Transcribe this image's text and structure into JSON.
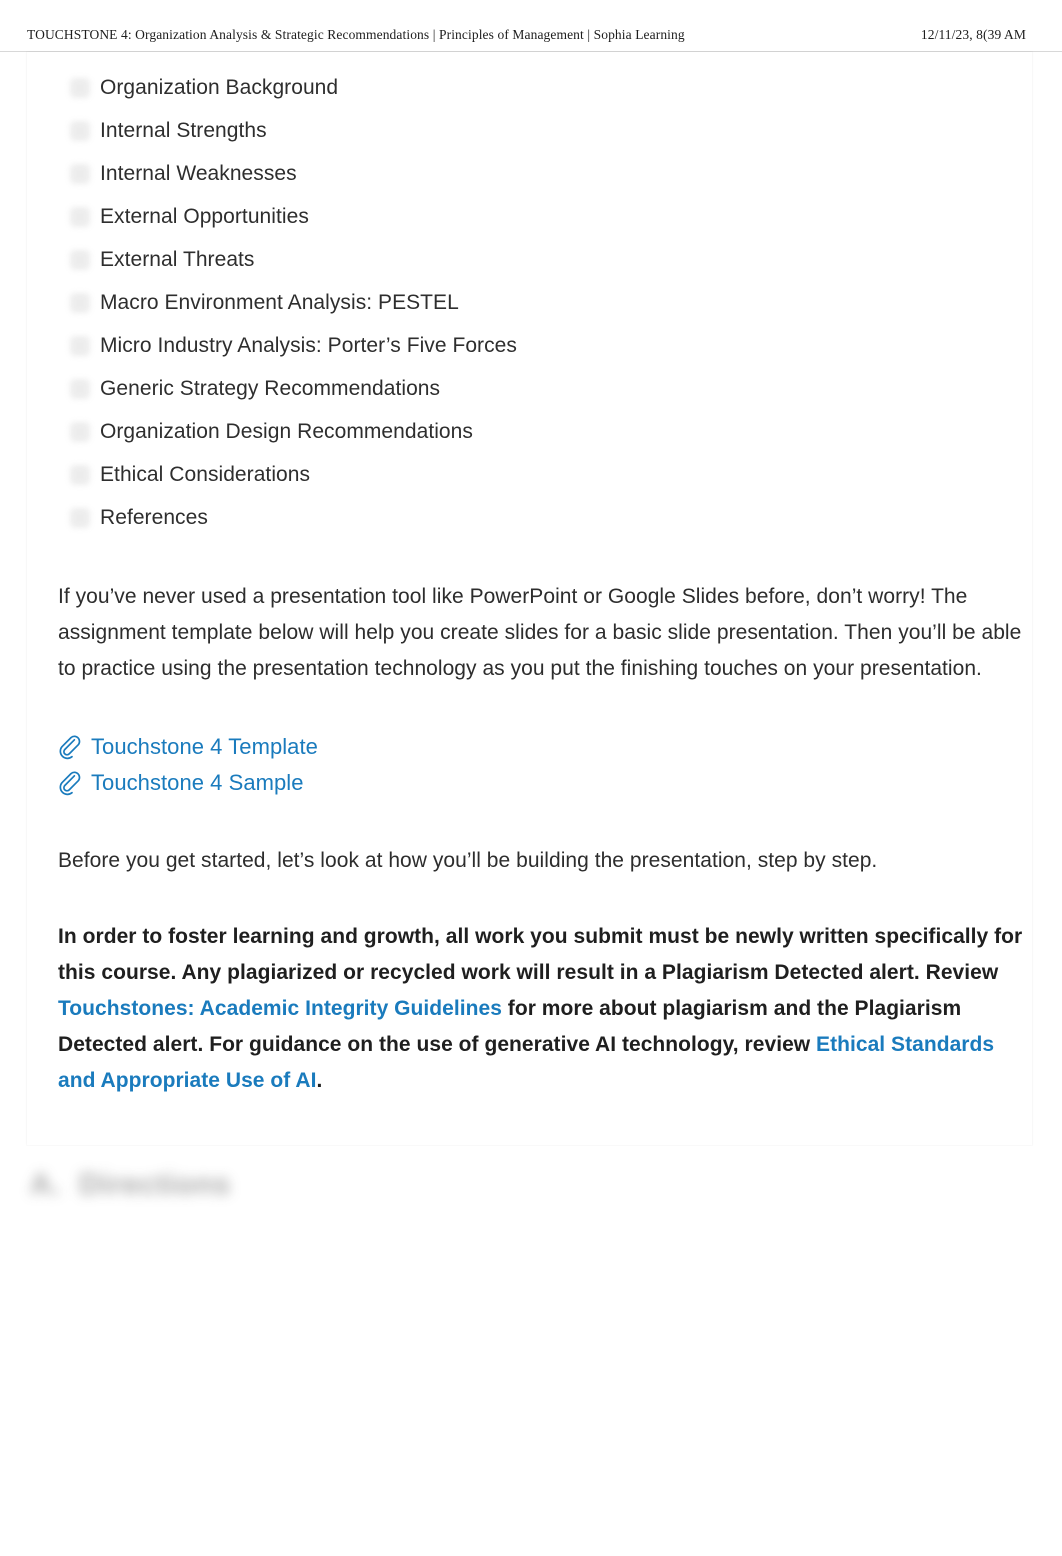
{
  "print_header": {
    "title": "TOUCHSTONE 4: Organization Analysis & Strategic Recommendations | Principles of Management | Sophia Learning",
    "date": "12/11/23, 8(39 AM"
  },
  "outline_list": {
    "bullet_icon": "square-placeholder-icon",
    "items": [
      "Organization Background",
      "Internal Strengths",
      "Internal Weaknesses",
      "External Opportunities",
      "External Threats",
      "Macro Environment Analysis: PESTEL",
      "Micro Industry Analysis: Porter’s Five Forces",
      "Generic Strategy Recommendations",
      "Organization Design Recommendations",
      "Ethical Considerations",
      "References"
    ]
  },
  "intro_paragraph": "If you’ve never used a presentation tool like PowerPoint or Google Slides before, don’t worry! The assignment template below will help you create slides for a basic slide presentation. Then you’ll be able to practice using the presentation technology as you put the finishing touches on your presentation.",
  "attachments": {
    "icon": "paperclip-icon",
    "items": [
      {
        "label": "Touchstone 4 Template"
      },
      {
        "label": "Touchstone 4 Sample"
      }
    ]
  },
  "before_paragraph": "Before you get started, let’s look at how you’ll be building the presentation, step by step.",
  "notice_paragraph": {
    "part1": "In order to foster learning and growth, all work you submit must be newly written specifically for this course. Any plagiarized or recycled work will result in a Plagiarism Detected alert. Review ",
    "link1": "Touchstones: Academic Integrity Guidelines",
    "part2": " for more about plagiarism and the Plagiarism Detected alert. For guidance on the use of generative AI technology, review ",
    "link2": "Ethical Standards and Appropriate Use of AI",
    "part3": "."
  },
  "blurred_heading": {
    "label": "A.",
    "text": "Directions"
  },
  "colors": {
    "link_blue": "#1a7bbd",
    "body_text": "#2d2d2d",
    "bullet_grey": "#ececec",
    "header_rule": "#d8d8d8"
  }
}
